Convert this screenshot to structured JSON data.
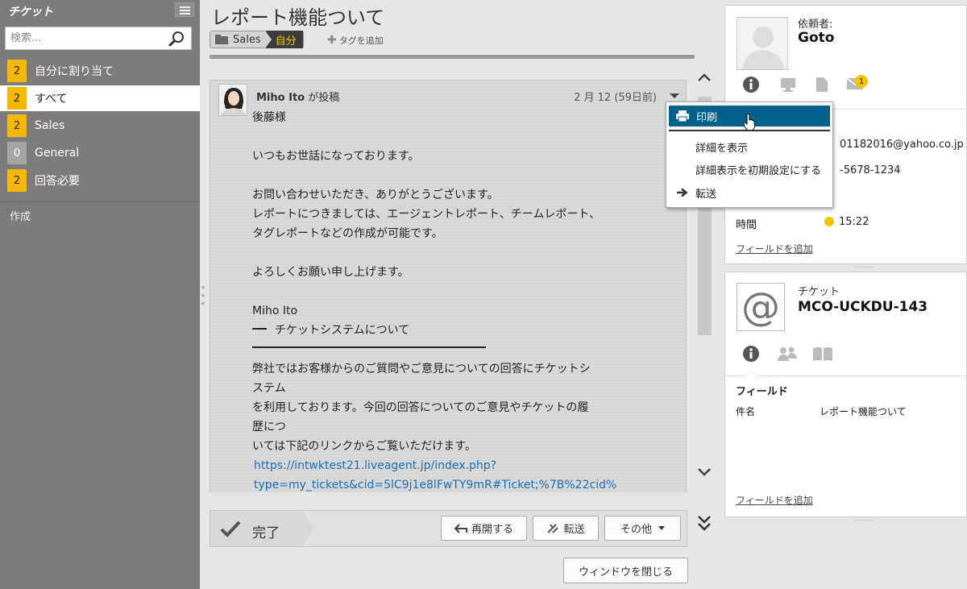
{
  "sidebar": {
    "title": "チケット",
    "search_placeholder": "検索...",
    "items": [
      {
        "count": "2",
        "label": "自分に割り当て"
      },
      {
        "count": "2",
        "label": "すべて"
      },
      {
        "count": "2",
        "label": "Sales"
      },
      {
        "count": "0",
        "label": "General"
      },
      {
        "count": "2",
        "label": "回答必要"
      }
    ],
    "create_label": "作成"
  },
  "ticket": {
    "title": "レポート機能ついて",
    "department": "Sales",
    "owner": "自分",
    "add_tag_label": "タグを追加"
  },
  "message": {
    "author": "Miho Ito",
    "author_suffix": " が投稿",
    "date": "2 月 12 (59日前)",
    "lines": [
      "後藤様",
      "",
      "いつもお世話になっております。",
      "",
      "お問い合わせいただき、ありがとうございます。",
      "レポートにつきましては、エージェントレポート、チームレポート、",
      "タグレポートなどの作成が可能です。",
      "",
      "よろしくお願い申し上げます。",
      "",
      "Miho Ito"
    ],
    "signature_title": "チケットシステムについて",
    "signature_lines": [
      "弊社ではお客様からのご質問やご意見についての回答にチケットシ",
      "ステム",
      "を利用しております。今回の回答についてのご意見やチケットの履",
      "歴につ",
      "いては下記のリンクからご覧いただけます。"
    ],
    "link_lines": [
      "https://intwktest21.liveagent.jp/index.php?",
      "type=my_tickets&cid=5lC9j1e8lFwTY9mR#Ticket;%7B%22cid%"
    ]
  },
  "dropdown": {
    "items": [
      {
        "label": "印刷",
        "icon": "printer-icon"
      },
      {
        "label": "詳細を表示"
      },
      {
        "label": "詳細表示を初期設定にする"
      },
      {
        "label": "転送",
        "icon": "arrow-right-icon"
      }
    ]
  },
  "actions": {
    "done_label": "完了",
    "reopen_label": "再開する",
    "forward_label": "転送",
    "more_label": "その他",
    "close_window_label": "ウィンドウを閉じる"
  },
  "requester": {
    "label": "依頼者:",
    "name": "Goto",
    "mail_badge": "1",
    "email_partial": "01182016@yahoo.co.jp",
    "phone_partial": "-5678-1234",
    "time_label": "時間",
    "time_value": "15:22",
    "add_field_label": "フィールドを追加"
  },
  "ticket_card": {
    "label": "チケット",
    "code": "MCO-UCKDU-143",
    "fields_heading": "フィールド",
    "subject_label": "件名",
    "subject_value": "レポート機能ついて",
    "add_field_label": "フィールドを追加"
  },
  "colors": {
    "sidebar_bg": "#7c7c7c",
    "badge": "#f5b800",
    "highlight": "#01608c",
    "link": "#1a6fb8"
  }
}
